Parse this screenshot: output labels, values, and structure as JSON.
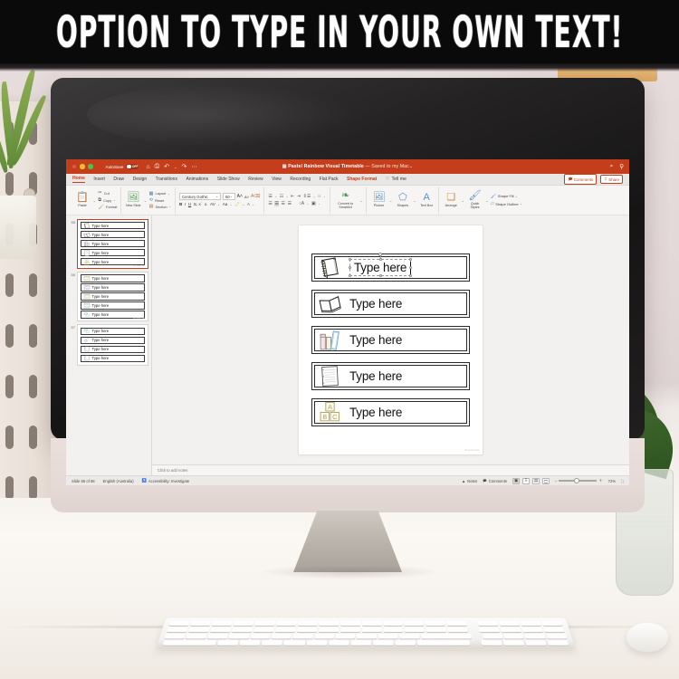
{
  "banner": {
    "text": "OPTION TO TYPE IN YOUR OWN TEXT!"
  },
  "window": {
    "autosave_label": "AutoSave",
    "autosave_state": "OFF",
    "doc_title": "Pastel Rainbow Visual Timetable",
    "doc_state": " — Saved to my Mac",
    "quick_icons": [
      "home-icon",
      "save-icon",
      "undo-icon",
      "redo-icon",
      "more-icon"
    ],
    "search_icon": "search-icon",
    "ribbon_display_icon": "ribbon-options-icon",
    "accent_color": "#c43e1c"
  },
  "tabs": [
    {
      "label": "Home",
      "state": "active"
    },
    {
      "label": "Insert",
      "state": "normal"
    },
    {
      "label": "Draw",
      "state": "normal"
    },
    {
      "label": "Design",
      "state": "normal"
    },
    {
      "label": "Transitions",
      "state": "normal"
    },
    {
      "label": "Animations",
      "state": "normal"
    },
    {
      "label": "Slide Show",
      "state": "normal"
    },
    {
      "label": "Review",
      "state": "normal"
    },
    {
      "label": "View",
      "state": "normal"
    },
    {
      "label": "Recording",
      "state": "normal"
    },
    {
      "label": "Flat Pack",
      "state": "normal"
    },
    {
      "label": "Shape Format",
      "state": "contextual"
    }
  ],
  "tellme": {
    "label": "Tell me",
    "icon": "lightbulb-icon"
  },
  "window_actions": {
    "comments": "Comments",
    "share": "Share"
  },
  "ribbon": {
    "paste": {
      "label": "Paste",
      "icon": "clipboard-icon"
    },
    "clipboard_items": [
      {
        "label": "Cut",
        "icon": "scissors-icon"
      },
      {
        "label": "Copy",
        "icon": "copy-icon"
      },
      {
        "label": "Format",
        "icon": "format-painter-icon"
      }
    ],
    "new_slide": {
      "label": "New Slide",
      "icon": "new-slide-icon"
    },
    "slide_items": [
      {
        "label": "Layout",
        "icon": "layout-icon"
      },
      {
        "label": "Reset",
        "icon": "reset-icon"
      },
      {
        "label": "Section",
        "icon": "section-icon"
      }
    ],
    "font_name": "Century Gothic",
    "font_size": "50",
    "font_buttons": [
      "B",
      "I",
      "U",
      "S",
      "x²",
      "x₂",
      "Aa"
    ],
    "increase_font_icon": "increase-font-icon",
    "decrease_font_icon": "decrease-font-icon",
    "clear_format_icon": "clear-formatting-icon",
    "highlight_icon": "text-highlight-icon",
    "font_color_icon": "font-color-icon",
    "paragraph_icons": [
      "bullets-icon",
      "numbering-icon",
      "decrease-indent-icon",
      "increase-indent-icon",
      "line-spacing-icon",
      "columns-icon"
    ],
    "align_icons": [
      "align-left-icon",
      "align-center-icon",
      "align-right-icon",
      "justify-icon"
    ],
    "text_direction_icon": "text-direction-icon",
    "align_text_icon": "align-text-icon",
    "convert_smartart": {
      "label": "Convert to SmartArt",
      "icon": "smartart-icon"
    },
    "picture": {
      "label": "Picture",
      "icon": "picture-icon"
    },
    "shapes": {
      "label": "Shapes",
      "icon": "shapes-icon"
    },
    "textbox": {
      "label": "Text Box",
      "icon": "textbox-icon"
    },
    "arrange": {
      "label": "Arrange",
      "icon": "arrange-icon"
    },
    "quick_styles": {
      "label": "Quick Styles",
      "icon": "quick-styles-icon"
    },
    "shape_fill": {
      "label": "Shape Fill",
      "icon": "shape-fill-icon"
    },
    "shape_outline": {
      "label": "Shape Outline",
      "icon": "shape-outline-icon"
    }
  },
  "thumbnails": [
    {
      "number": "55",
      "selected": true,
      "cards": [
        {
          "label": "Type here",
          "icon": "spiral-notebook-icon"
        },
        {
          "label": "Type here",
          "icon": "open-book-icon"
        },
        {
          "label": "Type here",
          "icon": "pencil-case-icon"
        },
        {
          "label": "Type here",
          "icon": "lined-paper-icon"
        },
        {
          "label": "Type here",
          "icon": "abc-blocks-icon"
        }
      ]
    },
    {
      "number": "56",
      "selected": false,
      "cards": [
        {
          "label": "Type here",
          "icon": "bookshelf-yellow-icon"
        },
        {
          "label": "Type here",
          "icon": "bookshelf-purple-icon"
        },
        {
          "label": "Type here",
          "icon": "bookshelf-green-icon"
        },
        {
          "label": "Type here",
          "icon": "bookshelf-blue-icon"
        },
        {
          "label": "Type here",
          "icon": "speech-bubbles-icon"
        }
      ]
    },
    {
      "number": "57",
      "selected": false,
      "cards": [
        {
          "label": "Type here",
          "icon": "speech-bubbles-icon"
        },
        {
          "label": "Type here",
          "icon": "writing-hand-icon"
        },
        {
          "label": "Type here",
          "icon": "notebook-icon"
        },
        {
          "label": "Type here",
          "icon": "notebook-icon"
        }
      ]
    }
  ],
  "slide": {
    "cards": [
      {
        "label": "Type here",
        "icon": "spiral-notebook-icon",
        "selected": true
      },
      {
        "label": "Type here",
        "icon": "open-book-icon",
        "selected": false
      },
      {
        "label": "Type here",
        "icon": "pencil-case-icon",
        "selected": false
      },
      {
        "label": "Type here",
        "icon": "lined-paper-icon",
        "selected": false
      },
      {
        "label": "Type here",
        "icon": "abc-blocks-icon",
        "selected": false
      }
    ],
    "credit": "Sa Lowe's Art"
  },
  "notes": {
    "placeholder": "Click to add notes"
  },
  "statusbar": {
    "slide_count": "Slide 55 of 68",
    "language": "English (Australia)",
    "accessibility": "Accessibility: Investigate",
    "accessibility_icon": "accessibility-icon",
    "notes_button": "Notes",
    "notes_icon": "notes-icon",
    "comments_button": "Comments",
    "comments_icon": "comment-icon",
    "view_buttons": [
      "normal-view-icon",
      "slide-sorter-icon",
      "reading-view-icon",
      "presenter-view-icon"
    ],
    "zoom_out_icon": "zoom-out-icon",
    "zoom_in_icon": "zoom-in-icon",
    "zoom_level": "72%",
    "fit_slide_icon": "fit-to-window-icon"
  }
}
